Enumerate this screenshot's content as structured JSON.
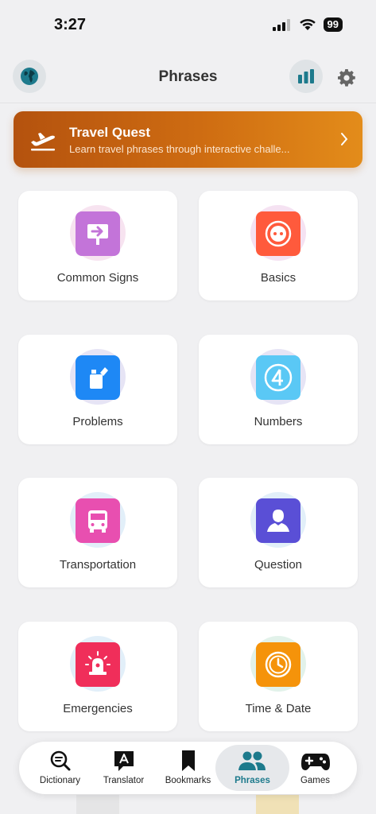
{
  "status_bar": {
    "time": "3:27",
    "battery": "99"
  },
  "header": {
    "title": "Phrases"
  },
  "banner": {
    "title": "Travel Quest",
    "subtitle": "Learn travel phrases through interactive challe..."
  },
  "categories": [
    {
      "label": "Common Signs",
      "icon": "signpost-icon",
      "color": "#c374d9"
    },
    {
      "label": "Basics",
      "icon": "smiley-icon",
      "color": "#ff5a3c"
    },
    {
      "label": "Problems",
      "icon": "lighter-icon",
      "color": "#1e88f5"
    },
    {
      "label": "Numbers",
      "icon": "number-four-icon",
      "color": "#5ac8f5"
    },
    {
      "label": "Transportation",
      "icon": "bus-icon",
      "color": "#e84fb0"
    },
    {
      "label": "Question",
      "icon": "person-icon",
      "color": "#5a4fd6"
    },
    {
      "label": "Emergencies",
      "icon": "siren-icon",
      "color": "#f02e5a"
    },
    {
      "label": "Time & Date",
      "icon": "clock-icon",
      "color": "#f5930a"
    }
  ],
  "tabs": [
    {
      "label": "Dictionary",
      "icon": "search-text-icon"
    },
    {
      "label": "Translator",
      "icon": "translate-bubble-icon"
    },
    {
      "label": "Bookmarks",
      "icon": "bookmark-icon"
    },
    {
      "label": "Phrases",
      "icon": "people-icon",
      "active": true
    },
    {
      "label": "Games",
      "icon": "gamepad-icon"
    }
  ],
  "colors": {
    "accent": "#1d7a8c",
    "banner_start": "#b4520e",
    "banner_end": "#e38c1a"
  }
}
